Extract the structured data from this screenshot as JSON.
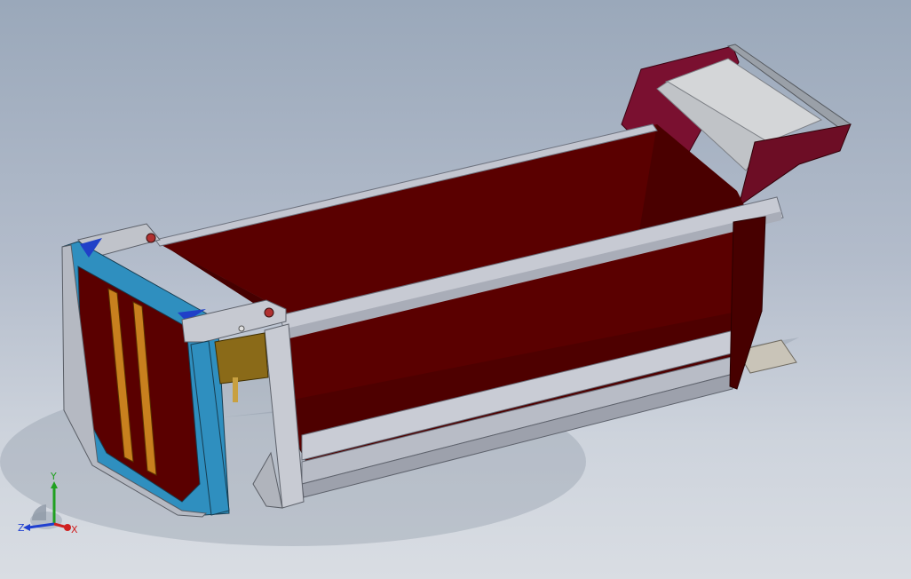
{
  "viewport": {
    "background_top": "#9aa8ba",
    "background_bottom": "#d9dde3"
  },
  "model": {
    "body_color": "#5a0000",
    "body_dark": "#3e0000",
    "rail_color": "#c3c6d0",
    "frame_color": "#2f8fbf",
    "post_color": "#c8801e",
    "tail_panel": "#7a1030",
    "tail_light": "#d4d6d8",
    "plate_color": "#8a6a18"
  },
  "triad": {
    "x_label": "X",
    "y_label": "Y",
    "z_label": "Z",
    "x_color": "#d02020",
    "y_color": "#20a020",
    "z_color": "#2040d0"
  }
}
